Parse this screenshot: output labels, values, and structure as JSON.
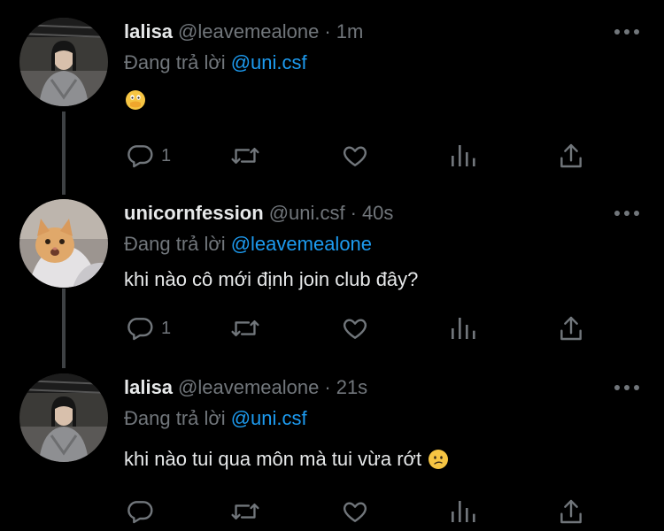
{
  "colors": {
    "background": "#000000",
    "text": "#e7e9ea",
    "muted": "#71767b",
    "accent": "#1d9bf0",
    "thread_line": "#3e4144"
  },
  "reply_prefix": "Đang trả lời",
  "tweets": [
    {
      "display_name": "lalisa",
      "handle": "@leavemealone",
      "time": "1m",
      "replying_to": "@uni.csf",
      "text": "",
      "emoji": "hand-over-mouth-emoji",
      "reply_count": "1",
      "avatar": "girl-hoodie-avatar"
    },
    {
      "display_name": "unicornfession",
      "handle": "@uni.csf",
      "time": "40s",
      "replying_to": "@leavemealone",
      "text": "khi nào cô mới định join club đây?",
      "emoji": "",
      "reply_count": "1",
      "avatar": "cat-avatar"
    },
    {
      "display_name": "lalisa",
      "handle": "@leavemealone",
      "time": "21s",
      "replying_to": "@uni.csf",
      "text": "khi nào tui qua môn mà tui vừa rớt",
      "emoji": "confused-face-emoji",
      "reply_count": "",
      "avatar": "girl-hoodie-avatar"
    }
  ],
  "icons": [
    "reply-icon",
    "retweet-icon",
    "like-icon",
    "analytics-icon",
    "share-icon",
    "more-icon"
  ]
}
